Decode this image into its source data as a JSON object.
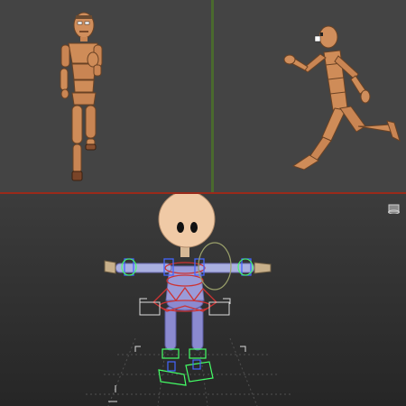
{
  "viewports": {
    "front": {
      "label": ""
    },
    "side": {
      "label": ""
    },
    "perspective": {
      "label": ""
    }
  },
  "colors": {
    "viewport_bg": "#444444",
    "perspective_bg_top": "#3c3c3c",
    "perspective_bg_bottom": "#262626",
    "skin": "#d09060",
    "rig_body": "#8c8ccf",
    "control_blue": "#4466ff",
    "control_green": "#44ff66",
    "control_red": "#cc3333"
  },
  "icons": [
    "viewcube-icon",
    "axis-tripod-icon"
  ]
}
